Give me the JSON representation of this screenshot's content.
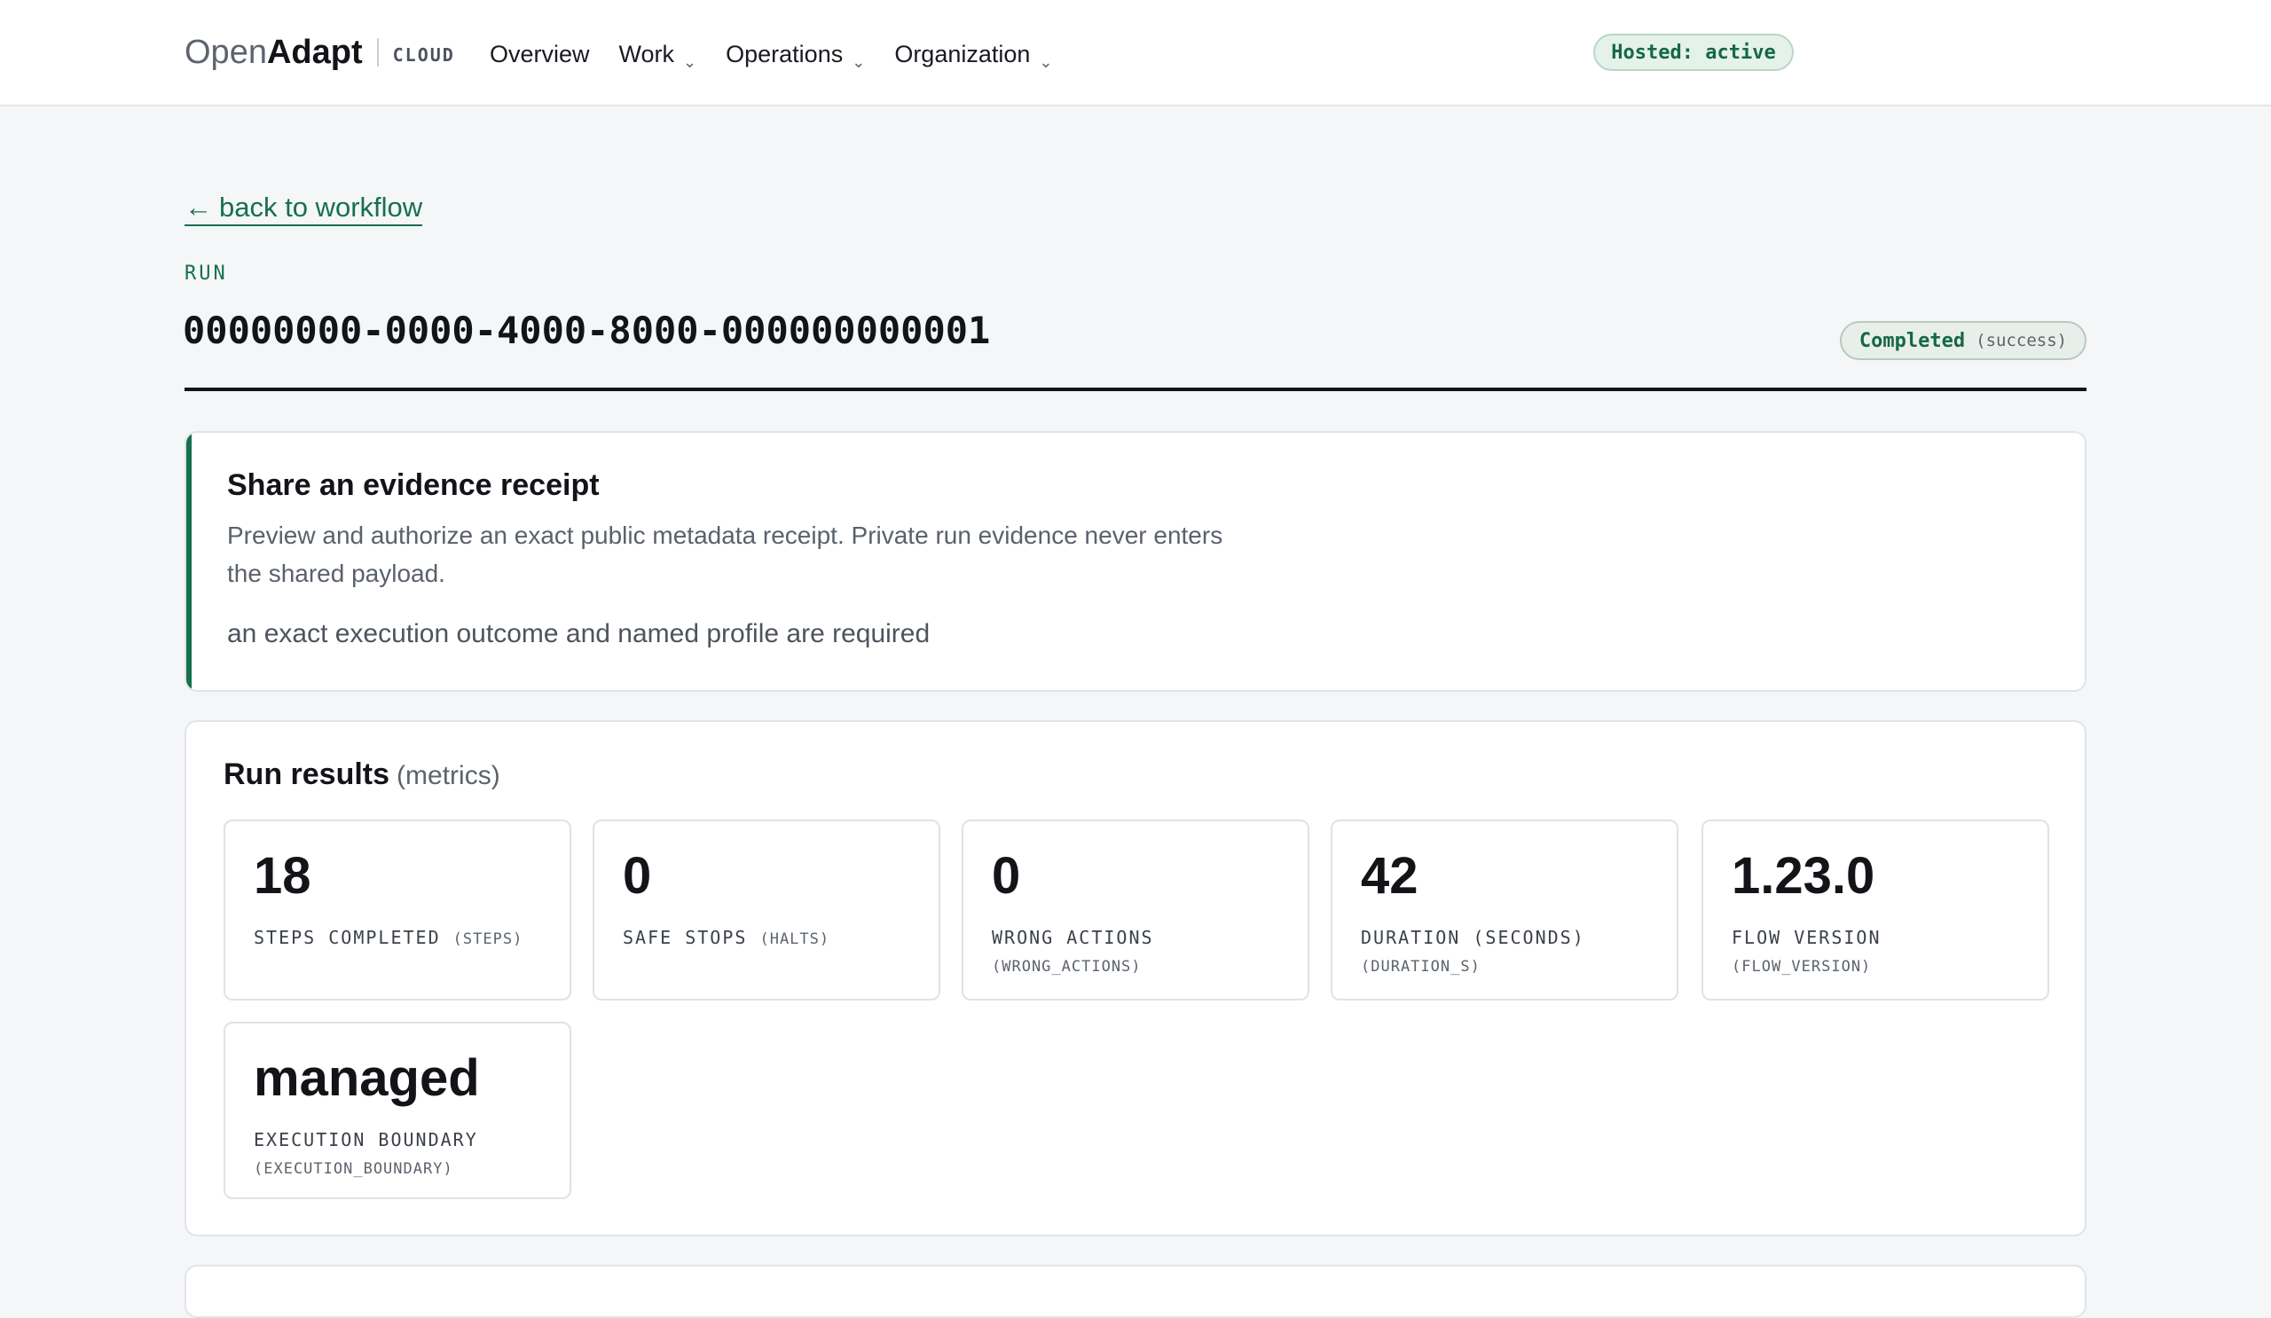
{
  "header": {
    "brand_open": "Open",
    "brand_adapt": "Adapt",
    "brand_suffix": "CLOUD",
    "nav": [
      {
        "label": "Overview"
      },
      {
        "label": "Work",
        "caret": "⌄"
      },
      {
        "label": "Operations",
        "caret": "⌄"
      },
      {
        "label": "Organization",
        "caret": "⌄"
      }
    ],
    "hosted_badge": "Hosted: active"
  },
  "main": {
    "back_link": "back to workflow",
    "back_arrow": "←",
    "eyebrow": "RUN",
    "run_id": "00000000-0000-4000-8000-000000000001",
    "status": {
      "label": "Completed",
      "detail": "(success)"
    }
  },
  "receipt": {
    "title": "Share an evidence receipt",
    "description": "Preview and authorize an exact public metadata receipt. Private run evidence never enters the shared payload.",
    "note": "an exact execution outcome and named profile are required"
  },
  "results": {
    "title": "Run results",
    "subtitle": "(metrics)",
    "metrics": [
      {
        "value": "18",
        "label": "STEPS COMPLETED",
        "key": "(STEPS)"
      },
      {
        "value": "0",
        "label": "SAFE STOPS",
        "key": "(HALTS)"
      },
      {
        "value": "0",
        "label": "WRONG ACTIONS",
        "key": "(WRONG_ACTIONS)"
      },
      {
        "value": "42",
        "label": "DURATION (SECONDS)",
        "key": "(DURATION_S)"
      },
      {
        "value": "1.23.0",
        "label": "FLOW VERSION",
        "key": "(FLOW_VERSION)"
      },
      {
        "value": "managed",
        "label": "EXECUTION BOUNDARY",
        "key": "(EXECUTION_BOUNDARY)"
      }
    ]
  },
  "colors": {
    "accent": "#16704d",
    "page_bg": "#f5f6f8",
    "text": "#121418"
  }
}
